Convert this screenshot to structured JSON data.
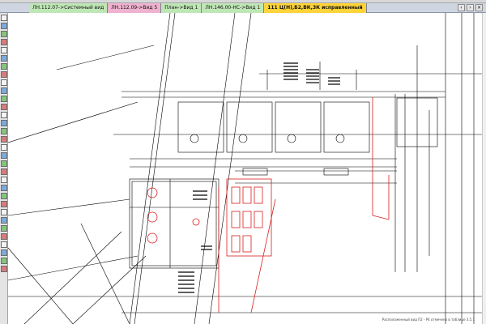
{
  "tabs": [
    {
      "label": "ЛН.112.07->Системный вид",
      "color": "green",
      "active": false
    },
    {
      "label": "ЛН.112.09->Вид 5",
      "color": "pink",
      "active": false
    },
    {
      "label": "План->Вид 1",
      "color": "green",
      "active": false
    },
    {
      "label": "ЛН.146.00-НС->Вид 1",
      "color": "green",
      "active": false
    },
    {
      "label": "111 Ц(Н),Б2,ВК,3К исправленный",
      "color": "orange",
      "active": true
    }
  ],
  "tab_nav": {
    "prev": "‹",
    "next": "›",
    "close": "×"
  },
  "toolbar_icons": [
    "select-icon",
    "line-icon",
    "polyline-icon",
    "arc-icon",
    "circle-icon",
    "rectangle-icon",
    "dimension-icon",
    "text-icon",
    "hatch-icon",
    "move-icon",
    "copy-icon",
    "rotate-icon",
    "mirror-icon",
    "scale-icon",
    "trim-icon",
    "extend-icon",
    "offset-icon",
    "fillet-icon",
    "layer-icon",
    "zoom-icon",
    "pan-icon",
    "measure-icon",
    "properties-icon",
    "snap-icon",
    "grid-icon",
    "ortho-icon",
    "print-icon",
    "save-icon",
    "undo-icon",
    "redo-icon",
    "erase-icon",
    "block-icon"
  ],
  "colors": {
    "drawing": "#000000",
    "highlight": "#d81e1e",
    "tab_active": "#ffd43a"
  },
  "drawing": {
    "status_caption": "Расположенный вид П2 - Р4 отмечено в таблице 3.5.1"
  }
}
